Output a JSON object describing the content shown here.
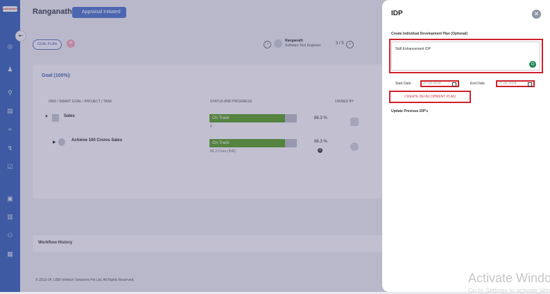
{
  "sidebar": {
    "logo": "usrinfotech"
  },
  "header": {
    "title": "Ranganath",
    "status": "Appraisal Initiated"
  },
  "toolbar": {
    "goal_plan": "GOAL PLAN",
    "add": "+"
  },
  "employee": {
    "name": "Ranganath",
    "role": "Software Test Engineer",
    "counter": "3 / 5"
  },
  "goal_section": {
    "title": "Goal (100%)",
    "separator": "|"
  },
  "table": {
    "headers": [
      "OKR / SMART GOAL / PROJECT / TASK",
      "STATUS AND PROGRESS",
      "OWNED BY"
    ],
    "rows": [
      {
        "name": "Sales",
        "status": "On Track",
        "progress": 0.863,
        "sub": "5",
        "percent": "86.3 %"
      },
      {
        "name": "Achieve 100 Crores Sales",
        "status": "On Track",
        "progress": 0.863,
        "sub": "86.3 Crore (INR)",
        "percent": "86.3 %"
      }
    ]
  },
  "workflow": {
    "label": "Workflow History"
  },
  "footer": {
    "copyright": "© 2013-24, USR Infotech Solutions Pvt Ltd. All Rights Reserved."
  },
  "drawer": {
    "title": "IDP",
    "close": "✕",
    "create_label": "Create Individual Development Plan (Optional)",
    "description": "Skill Enhancement IDP",
    "start_label": "Start Date",
    "start_value": "27-03-2024",
    "end_label": "End Date",
    "end_value": "27-06-2024",
    "create_button": "CREATE DEVELOPMENT PLAN",
    "update_label": "Update Previous IDP's"
  },
  "watermark": {
    "line1": "Activate Windows",
    "line2": "Go to Settings to activate Windows."
  },
  "colors": {
    "accent": "#3b66b8",
    "highlight": "#d01f2a",
    "progress": "#5c9e2e"
  }
}
